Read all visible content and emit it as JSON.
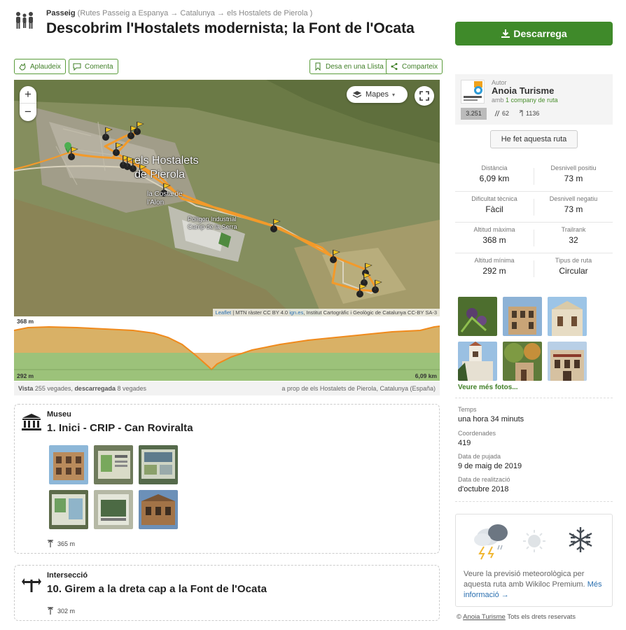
{
  "header": {
    "kind": "Passeig",
    "crumbs": "(Rutes Passeig a Espanya → Catalunya → els Hostalets de Pierola )",
    "title": "Descobrim l'Hostalets modernista; la Font de l'Ocata",
    "icon": "hikers-icon"
  },
  "actions": {
    "applaud": "Aplaudeix",
    "comment": "Comenta",
    "save_list": "Desa en una Llista",
    "share": "Comparteix"
  },
  "map": {
    "zoom_in": "+",
    "zoom_out": "−",
    "layers_label": "Mapes",
    "town_label": "els Hostalets de Pierola",
    "place_label_1": "la Costa de l'Alon",
    "place_label_2": "Polígon Industrial Camp de la Serra",
    "attribution_leaflet": "Leaflet",
    "attribution_mid": "| MTN ràster CC BY 4.0",
    "attribution_ign": "ign.es",
    "attribution_end": ", Institut Cartogràfic i Geològic de Catalunya CC-BY SA-3",
    "colors": {
      "track": "#f39a2a"
    }
  },
  "elevation": {
    "max_label": "368 m",
    "min_label": "292 m",
    "dist_label": "6,09 km"
  },
  "stats_line": {
    "views_label": "Vista",
    "views_value": "255 vegades,",
    "downloads_label": "descarregada",
    "downloads_value": "8 vegades",
    "near": "a prop de els Hostalets de Pierola, Catalunya (España)"
  },
  "waypoints": [
    {
      "type": "Museu",
      "name": "1. Inici - CRIP - Can Roviralta",
      "altitude": "365 m",
      "icon": "museum-icon"
    },
    {
      "type": "Intersecció",
      "name": "10. Girem a la dreta cap a la Font de l'Ocata",
      "altitude": "302 m",
      "icon": "intersection-icon"
    }
  ],
  "sidebar": {
    "download": "Descarrega",
    "author_label": "Autor",
    "author_name": "Anoia Turisme",
    "author_sub_prefix": "amb",
    "author_sub_link": "1 company de ruta",
    "rank": "3.251",
    "followers": "62",
    "trails": "1136",
    "done_button": "He fet aquesta ruta",
    "stats": [
      {
        "label": "Distància",
        "value": "6,09 km"
      },
      {
        "label": "Desnivell positiu",
        "value": "73 m"
      },
      {
        "label": "Dificultat tècnica",
        "value": "Fàcil"
      },
      {
        "label": "Desnivell negatiu",
        "value": "73 m"
      },
      {
        "label": "Altitud màxima",
        "value": "368 m"
      },
      {
        "label": "Trailrank",
        "value": "32"
      },
      {
        "label": "Altitud mínima",
        "value": "292 m"
      },
      {
        "label": "Tipus de ruta",
        "value": "Circular"
      }
    ],
    "more_photos": "Veure més fotos...",
    "meta": [
      {
        "label": "Temps",
        "value": "una hora 34 minuts"
      },
      {
        "label": "Coordenades",
        "value": "419"
      },
      {
        "label": "Data de pujada",
        "value": "9 de maig de 2019"
      },
      {
        "label": "Data de realització",
        "value": "d'octubre 2018"
      }
    ],
    "weather_text": "Veure la previsió meteorològica per aquesta ruta amb Wikiloc Premium.",
    "weather_link": "Més informació →",
    "rights_owner": "Anoia Turisme",
    "rights_text": "Tots els drets reservats",
    "brand_green": "#3f8a2a"
  }
}
